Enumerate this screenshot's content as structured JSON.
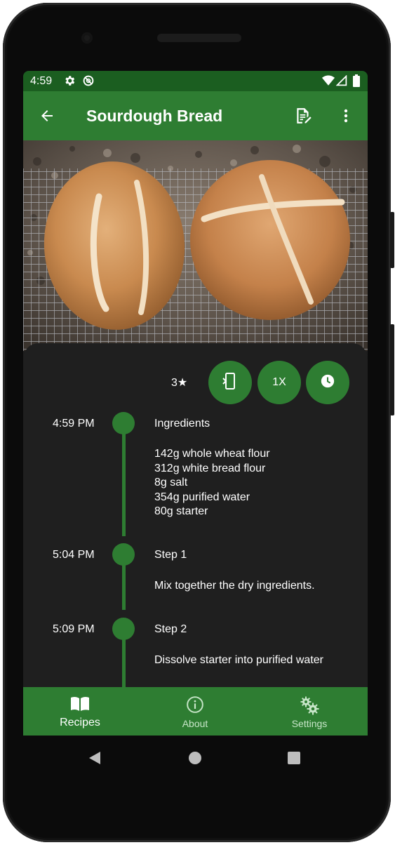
{
  "status_bar": {
    "time": "4:59",
    "icons": [
      "gear-icon",
      "sync-icon",
      "wifi-icon",
      "signal-icon",
      "battery-icon"
    ]
  },
  "app_bar": {
    "title": "Sourdough Bread",
    "back_icon": "arrow-back-icon",
    "edit_icon": "edit-note-icon",
    "menu_icon": "more-vert-icon"
  },
  "recipe": {
    "rating": "3★",
    "actions": [
      {
        "name": "keep-screen-on",
        "icon": "phone-icon"
      },
      {
        "name": "scale",
        "label": "1X"
      },
      {
        "name": "timer",
        "icon": "clock-icon"
      }
    ],
    "timeline": [
      {
        "time": "4:59 PM",
        "title": "Ingredients",
        "lines": [
          "142g whole wheat flour",
          "312g white bread flour",
          "8g salt",
          "354g purified water",
          "80g starter"
        ]
      },
      {
        "time": "5:04 PM",
        "title": "Step 1",
        "lines": [
          "Mix together the dry ingredients."
        ]
      },
      {
        "time": "5:09 PM",
        "title": "Step 2",
        "lines": [
          "Dissolve starter into purified water"
        ]
      }
    ]
  },
  "bottom_nav": [
    {
      "label": "Recipes",
      "icon": "book-icon",
      "active": true
    },
    {
      "label": "About",
      "icon": "info-icon",
      "active": false
    },
    {
      "label": "Settings",
      "icon": "gears-icon",
      "active": false
    }
  ],
  "colors": {
    "primary": "#2e7d32",
    "primary_dark": "#1b5e20",
    "surface": "#1f1f1f",
    "on_primary": "#ffffff"
  }
}
